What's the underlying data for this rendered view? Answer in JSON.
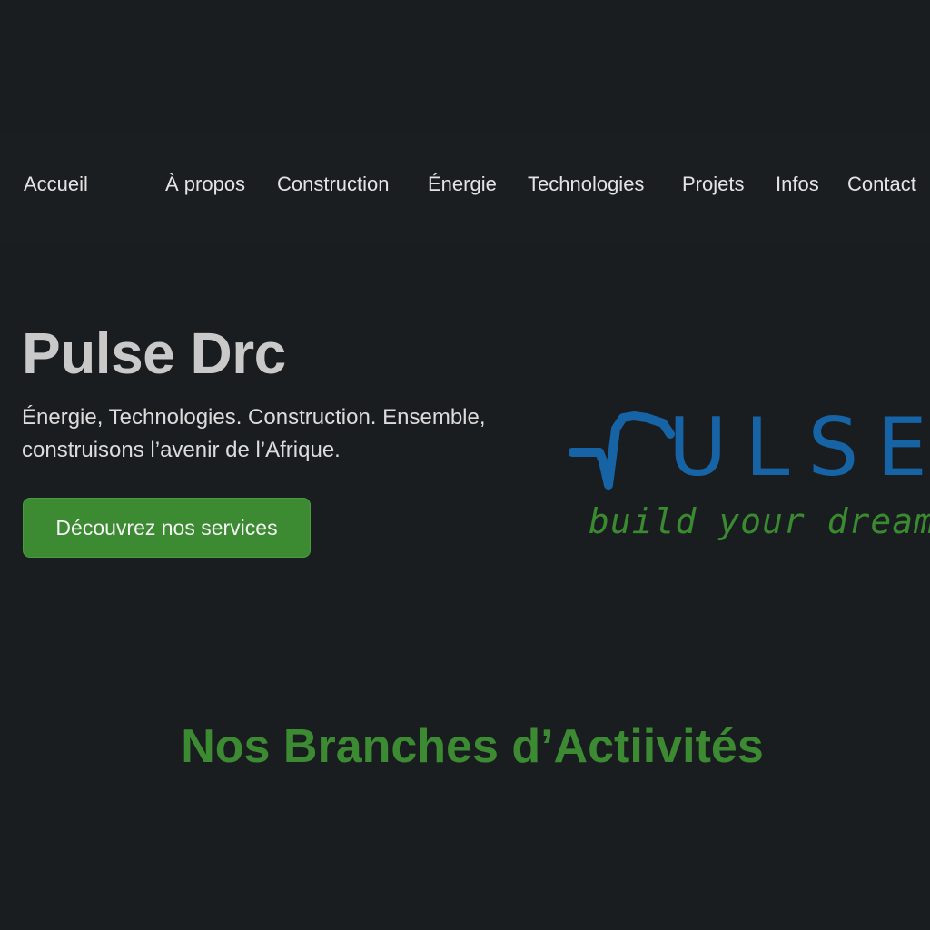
{
  "nav": {
    "items": [
      {
        "label": "Accueil"
      },
      {
        "label": "À propos"
      },
      {
        "label": "Construction"
      },
      {
        "label": "Énergie"
      },
      {
        "label": "Technologies"
      },
      {
        "label": "Projets"
      },
      {
        "label": "Infos"
      },
      {
        "label": "Contact"
      }
    ]
  },
  "hero": {
    "title": "Pulse Drc",
    "subtitle": "Énergie, Technologies. Construction. Ensemble, construisons l’avenir de l’Afrique.",
    "cta_label": "Découvrez nos services"
  },
  "logo": {
    "wordmark": "PULSE",
    "tagline": "build your dreams",
    "colors": {
      "wordmark": "#1663a6",
      "tagline": "#3a8a30"
    }
  },
  "section": {
    "title": "Nos Branches d’Actiivités"
  },
  "colors": {
    "background": "#1a1d20",
    "accent_green": "#3c8a32",
    "brand_blue": "#1663a6"
  }
}
